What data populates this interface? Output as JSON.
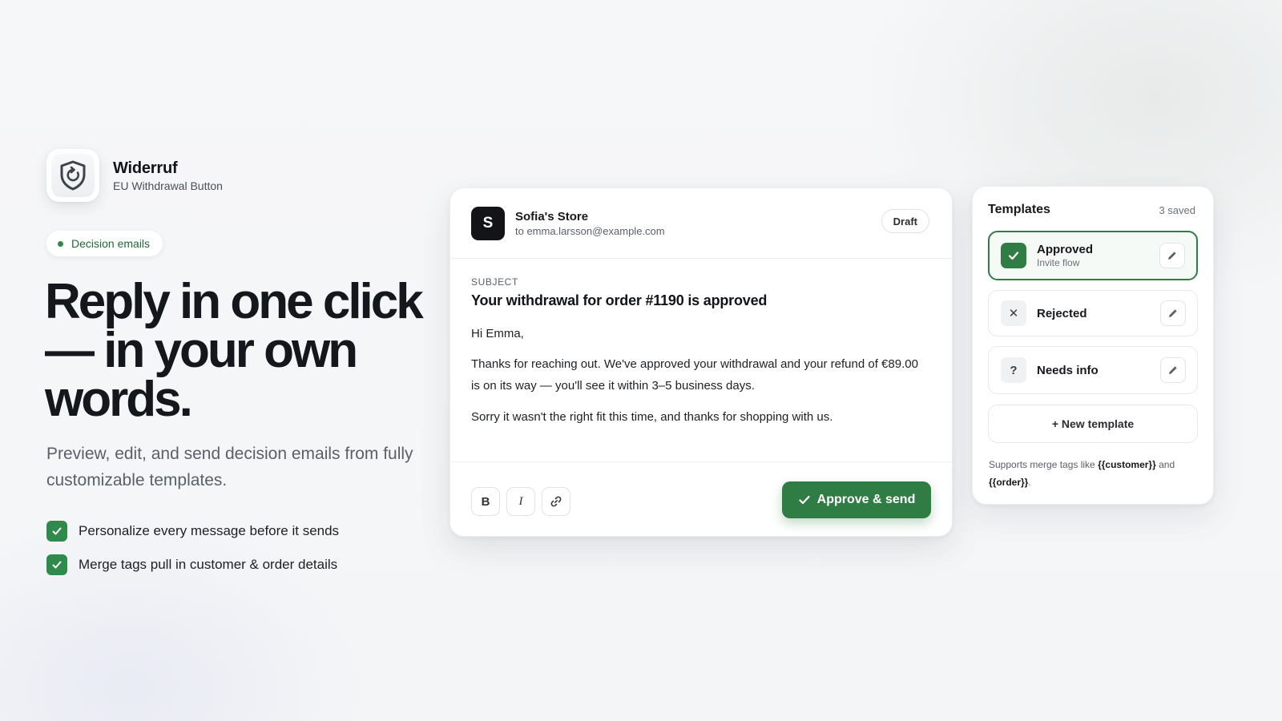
{
  "brand": {
    "name": "Widerruf",
    "subtitle": "EU Withdrawal Button",
    "icon": "shield-refresh-icon"
  },
  "hero": {
    "pill": "Decision emails",
    "headline": "Reply in one click — in your own words.",
    "subcopy": "Preview, edit, and send decision emails from fully customizable templates.",
    "bullets": [
      "Personalize every message before it sends",
      "Merge tags pull in customer & order details"
    ]
  },
  "email": {
    "sender_initial": "S",
    "sender_name": "Sofia's Store",
    "recipient": "to emma.larsson@example.com",
    "status": "Draft",
    "subject_label": "SUBJECT",
    "subject": "Your withdrawal for order #1190 is approved",
    "greeting": "Hi Emma,",
    "paragraph1": "Thanks for reaching out. We've approved your withdrawal and your refund of €89.00 is on its way — you'll see it within 3–5 business days.",
    "paragraph2": "Sorry it wasn't the right fit this time, and thanks for shopping with us.",
    "format_buttons": {
      "bold": "B",
      "italic": "I",
      "link_icon": "link-icon"
    },
    "send_button": "Approve & send"
  },
  "templates": {
    "title": "Templates",
    "count": "3 saved",
    "items": [
      {
        "name": "Approved",
        "sub": "Invite flow",
        "icon": "check-icon",
        "active": true
      },
      {
        "name": "Rejected",
        "icon": "x-icon",
        "glyph": "✕"
      },
      {
        "name": "Needs info",
        "icon": "question-icon",
        "glyph": "?"
      }
    ],
    "new_button": "+ New template",
    "note_prefix": "Supports merge tags like ",
    "note_tag1": "{{customer}}",
    "note_mid": " and ",
    "note_tag2": "{{order}}",
    "note_suffix": "."
  },
  "colors": {
    "accent": "#2f7d45",
    "dark": "#121418"
  }
}
